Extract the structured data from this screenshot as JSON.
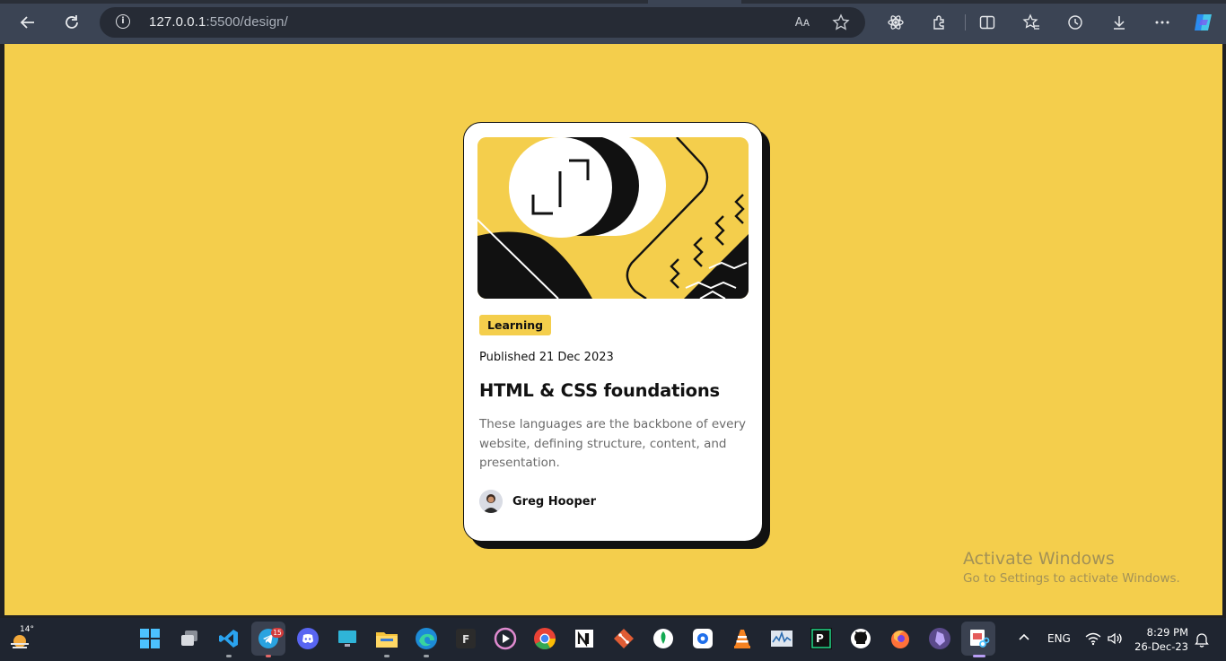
{
  "browser": {
    "url_host": "127.0.0.1",
    "url_path": ":5500/design/",
    "icons": [
      "back-arrow-icon",
      "refresh-icon",
      "site-info-icon",
      "read-aloud-icon",
      "favorite-star-icon",
      "react-devtools-icon",
      "extensions-icon",
      "split-screen-icon",
      "favorites-icon",
      "history-icon",
      "downloads-icon",
      "more-menu-icon",
      "copilot-icon"
    ],
    "read_aloud_glyph": "Aᴀ"
  },
  "card": {
    "tag": "Learning",
    "published": "Published 21 Dec 2023",
    "title": "HTML & CSS foundations",
    "description": "These languages are the backbone of every website, defining structure, content, and presentation.",
    "author": "Greg Hooper",
    "colors": {
      "accent": "#f4ce4c",
      "ink": "#111111",
      "muted": "#6b6b6b"
    }
  },
  "watermark": {
    "title": "Activate Windows",
    "subtitle": "Go to Settings to activate Windows."
  },
  "taskbar": {
    "weather_temp": "14°",
    "telegram_badge": "15",
    "language": "ENG",
    "time": "8:29 PM",
    "date": "26-Dec-23",
    "apps": [
      "start",
      "task-view",
      "vscode",
      "telegram",
      "discord",
      "remote-desktop",
      "file-explorer",
      "edge",
      "figma-like",
      "media-player",
      "chrome",
      "notion",
      "git",
      "mongodb",
      "sourcetree",
      "vlc",
      "resource-monitor",
      "pycharm",
      "github-desktop",
      "firefox",
      "obsidian",
      "snipping-tool"
    ]
  }
}
